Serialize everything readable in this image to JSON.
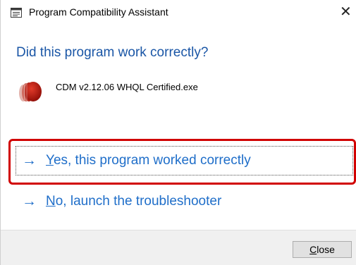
{
  "window": {
    "title": "Program Compatibility Assistant",
    "close_glyph": "✕"
  },
  "main": {
    "heading": "Did this program work correctly?",
    "program": {
      "name": "CDM v2.12.06 WHQL Certified.exe",
      "icon": "cdm-program-icon"
    },
    "options": [
      {
        "arrow": "→",
        "accel": "Y",
        "rest": "es, this program worked correctly",
        "highlighted": true
      },
      {
        "arrow": "→",
        "accel": "N",
        "rest": "o, launch the troubleshooter",
        "highlighted": false
      }
    ]
  },
  "footer": {
    "close_accel": "C",
    "close_rest": "lose"
  },
  "colors": {
    "heading": "#1a56a6",
    "link": "#1f6ec9",
    "highlight": "#d10000",
    "footer_bg": "#f0f0f0"
  }
}
